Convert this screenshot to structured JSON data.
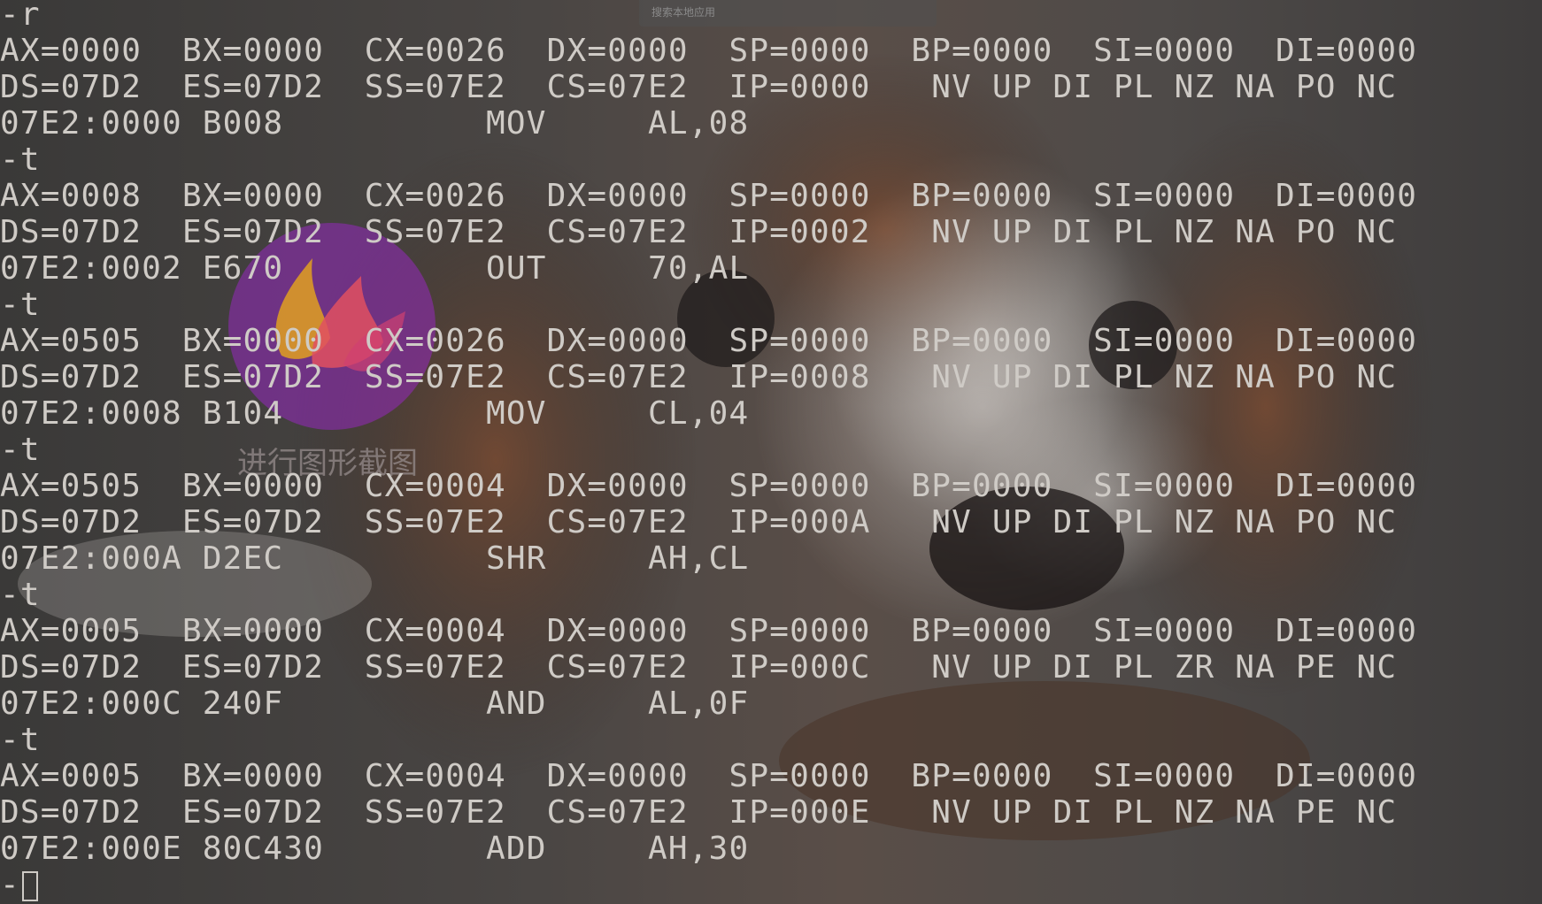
{
  "topbar": {
    "text": "搜索本地应用"
  },
  "overlay": {
    "label": "进行图形截图"
  },
  "terminal": {
    "lines": [
      "-r",
      "AX=0000  BX=0000  CX=0026  DX=0000  SP=0000  BP=0000  SI=0000  DI=0000",
      "DS=07D2  ES=07D2  SS=07E2  CS=07E2  IP=0000   NV UP DI PL NZ NA PO NC",
      "07E2:0000 B008          MOV     AL,08",
      "-t",
      "AX=0008  BX=0000  CX=0026  DX=0000  SP=0000  BP=0000  SI=0000  DI=0000",
      "DS=07D2  ES=07D2  SS=07E2  CS=07E2  IP=0002   NV UP DI PL NZ NA PO NC",
      "07E2:0002 E670          OUT     70,AL",
      "-t",
      "AX=0505  BX=0000  CX=0026  DX=0000  SP=0000  BP=0000  SI=0000  DI=0000",
      "DS=07D2  ES=07D2  SS=07E2  CS=07E2  IP=0008   NV UP DI PL NZ NA PO NC",
      "07E2:0008 B104          MOV     CL,04",
      "-t",
      "AX=0505  BX=0000  CX=0004  DX=0000  SP=0000  BP=0000  SI=0000  DI=0000",
      "DS=07D2  ES=07D2  SS=07E2  CS=07E2  IP=000A   NV UP DI PL NZ NA PO NC",
      "07E2:000A D2EC          SHR     AH,CL",
      "-t",
      "AX=0005  BX=0000  CX=0004  DX=0000  SP=0000  BP=0000  SI=0000  DI=0000",
      "DS=07D2  ES=07D2  SS=07E2  CS=07E2  IP=000C   NV UP DI PL ZR NA PE NC",
      "07E2:000C 240F          AND     AL,0F",
      "-t",
      "AX=0005  BX=0000  CX=0004  DX=0000  SP=0000  BP=0000  SI=0000  DI=0000",
      "DS=07D2  ES=07D2  SS=07E2  CS=07E2  IP=000E   NV UP DI PL NZ NA PE NC",
      "07E2:000E 80C430        ADD     AH,30"
    ],
    "prompt": "-"
  }
}
